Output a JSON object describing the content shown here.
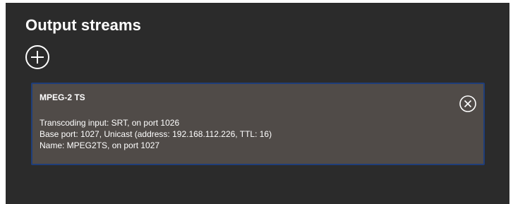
{
  "panel": {
    "title": "Output streams"
  },
  "icons": {
    "add": "plus-circle-icon",
    "remove": "x-circle-icon"
  },
  "colors": {
    "panel_background": "#2b2b2b",
    "card_background": "#504b48",
    "card_border": "#1f3e7a",
    "text": "#ffffff"
  },
  "stream": {
    "title": "MPEG-2 TS",
    "lines": [
      "Transcoding input: SRT, on port 1026",
      "Base port: 1027, Unicast (address: 192.168.112.226, TTL: 16)",
      "Name: MPEG2TS, on port 1027"
    ]
  }
}
